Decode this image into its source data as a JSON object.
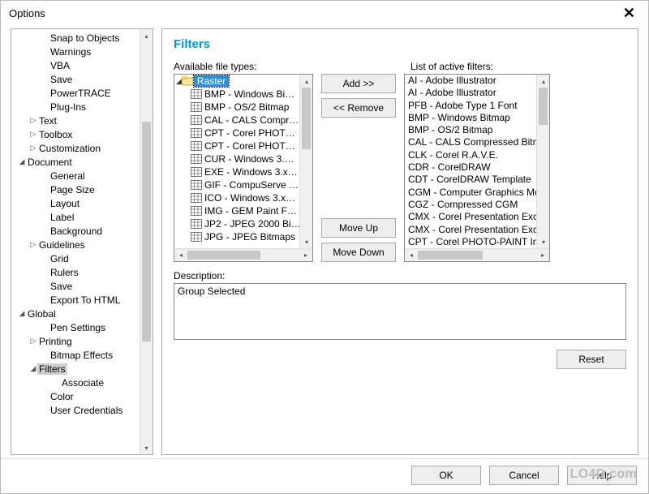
{
  "window": {
    "title": "Options",
    "close_tooltip": "Close"
  },
  "tree": [
    {
      "indent": 2,
      "exp": "",
      "label": "Snap to Objects"
    },
    {
      "indent": 2,
      "exp": "",
      "label": "Warnings"
    },
    {
      "indent": 2,
      "exp": "",
      "label": "VBA"
    },
    {
      "indent": 2,
      "exp": "",
      "label": "Save"
    },
    {
      "indent": 2,
      "exp": "",
      "label": "PowerTRACE"
    },
    {
      "indent": 2,
      "exp": "",
      "label": "Plug-Ins"
    },
    {
      "indent": 1,
      "exp": "▷",
      "label": "Text"
    },
    {
      "indent": 1,
      "exp": "▷",
      "label": "Toolbox"
    },
    {
      "indent": 1,
      "exp": "▷",
      "label": "Customization"
    },
    {
      "indent": 0,
      "exp": "◢",
      "label": "Document"
    },
    {
      "indent": 2,
      "exp": "",
      "label": "General"
    },
    {
      "indent": 2,
      "exp": "",
      "label": "Page Size"
    },
    {
      "indent": 2,
      "exp": "",
      "label": "Layout"
    },
    {
      "indent": 2,
      "exp": "",
      "label": "Label"
    },
    {
      "indent": 2,
      "exp": "",
      "label": "Background"
    },
    {
      "indent": 1,
      "exp": "▷",
      "label": "Guidelines"
    },
    {
      "indent": 2,
      "exp": "",
      "label": "Grid"
    },
    {
      "indent": 2,
      "exp": "",
      "label": "Rulers"
    },
    {
      "indent": 2,
      "exp": "",
      "label": "Save"
    },
    {
      "indent": 2,
      "exp": "",
      "label": "Export To HTML"
    },
    {
      "indent": 0,
      "exp": "◢",
      "label": "Global"
    },
    {
      "indent": 2,
      "exp": "",
      "label": "Pen Settings"
    },
    {
      "indent": 1,
      "exp": "▷",
      "label": "Printing"
    },
    {
      "indent": 2,
      "exp": "",
      "label": "Bitmap Effects"
    },
    {
      "indent": 1,
      "exp": "◢",
      "label": "Filters",
      "selected": true
    },
    {
      "indent": 3,
      "exp": "",
      "label": "Associate"
    },
    {
      "indent": 2,
      "exp": "",
      "label": "Color"
    },
    {
      "indent": 2,
      "exp": "",
      "label": "User Credentials"
    }
  ],
  "panel": {
    "title": "Filters",
    "avail_label": "Available file types:",
    "active_label": "List of active filters:",
    "raster_label": "Raster",
    "desc_label": "Description:",
    "desc_value": "Group Selected"
  },
  "avail_files": [
    "BMP - Windows Bi…",
    "BMP - OS/2 Bitmap",
    "CAL - CALS Compr…",
    "CPT - Corel PHOT…",
    "CPT - Corel PHOT…",
    "CUR - Windows 3.…",
    "EXE - Windows 3.x…",
    "GIF - CompuServe …",
    "ICO - Windows 3.x…",
    "IMG - GEM Paint F…",
    "JP2 - JPEG 2000 Bi…",
    "JPG - JPEG Bitmaps"
  ],
  "active_filters": [
    "AI - Adobe Illustrator",
    "AI - Adobe Illustrator",
    "PFB - Adobe Type 1 Font",
    "BMP - Windows Bitmap",
    "BMP - OS/2 Bitmap",
    "CAL - CALS Compressed Bitmap",
    "CLK - Corel R.A.V.E.",
    "CDR - CorelDRAW",
    "CDT - CorelDRAW Template",
    "CGM - Computer Graphics Meta",
    "CGZ - Compressed CGM",
    "CMX - Corel Presentation Excha",
    "CMX - Corel Presentation Excha",
    "CPT - Corel PHOTO-PAINT Imag"
  ],
  "buttons": {
    "add": "Add  >>",
    "remove": "<<  Remove",
    "move_up": "Move Up",
    "move_down": "Move Down",
    "reset": "Reset",
    "ok": "OK",
    "cancel": "Cancel",
    "help": "Help"
  },
  "watermark": "LO4D.com"
}
